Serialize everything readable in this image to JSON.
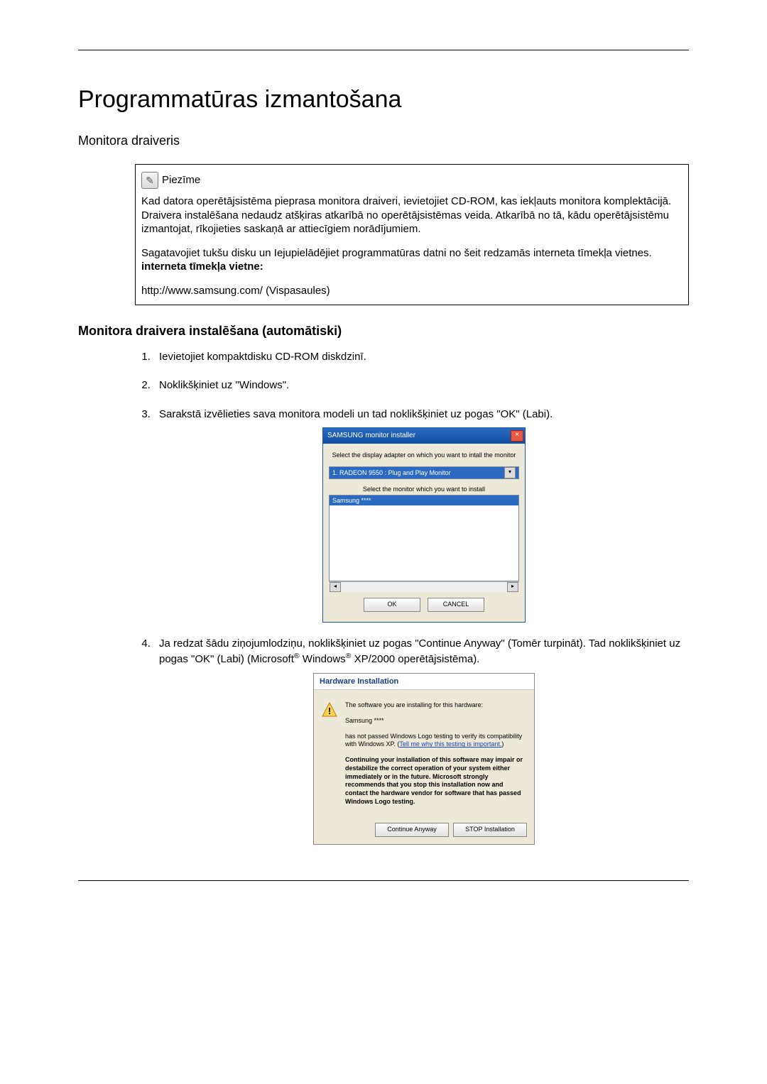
{
  "title": "Programmatūras izmantošana",
  "section1": "Monitora draiveris",
  "note": {
    "icon_glyph": "✎",
    "label": "Piezīme",
    "p1": "Kad datora operētājsistēma pieprasa monitora draiveri, ievietojiet CD-ROM, kas iekļauts monitora komplektācijā. Draivera instalēšana nedaudz atšķiras atkarībā no operētājsistēmas veida. Atkarībā no tā, kādu operētājsistēmu izmantojat, rīkojieties saskaņā ar attiecīgiem norādījumiem.",
    "p2": "Sagatavojiet tukšu disku un Iejupielādējiet programmatūras datni no šeit redzamās interneta tīmekļa vietnes.",
    "bold": "interneta tīmekļa vietne:",
    "p3": "http://www.samsung.com/ (Vispasaules)"
  },
  "section2": "Monitora draivera instalēšana (automātiski)",
  "steps": {
    "s1": "Ievietojiet kompaktdisku CD-ROM diskdzinī.",
    "s2": "Noklikšķiniet uz \"Windows\".",
    "s3": "Sarakstā izvēlieties sava monitora modeli un tad noklikšķiniet uz pogas \"OK\" (Labi).",
    "s4a": "Ja redzat šādu ziņojumlodziņu, noklikšķiniet uz pogas \"Continue Anyway\" (Tomēr turpināt). Tad noklikšķiniet uz pogas \"OK\" (Labi) (Microsoft",
    "s4b": " Windows",
    "s4c": " XP/2000 operētājsistēma)."
  },
  "dlg1": {
    "title": "SAMSUNG monitor installer",
    "label1": "Select the display adapter on which you want to intall the monitor",
    "select_value": "1. RADEON 9550 : Plug and Play Monitor",
    "label2": "Select the monitor which you want to install",
    "listitem": "Samsung ****",
    "ok": "OK",
    "cancel": "CANCEL"
  },
  "dlg2": {
    "title": "Hardware Installation",
    "l1": "The software you are installing for this hardware:",
    "l2": "Samsung ****",
    "l3a": "has not passed Windows Logo testing to verify its compatibility with Windows XP. (",
    "l3link": "Tell me why this testing is important.",
    "l3b": ")",
    "l4": "Continuing your installation of this software may impair or destabilize the correct operation of your system either immediately or in the future. Microsoft strongly recommends that you stop this installation now and contact the hardware vendor for software that has passed Windows Logo testing.",
    "btn_continue": "Continue Anyway",
    "btn_stop": "STOP Installation"
  }
}
